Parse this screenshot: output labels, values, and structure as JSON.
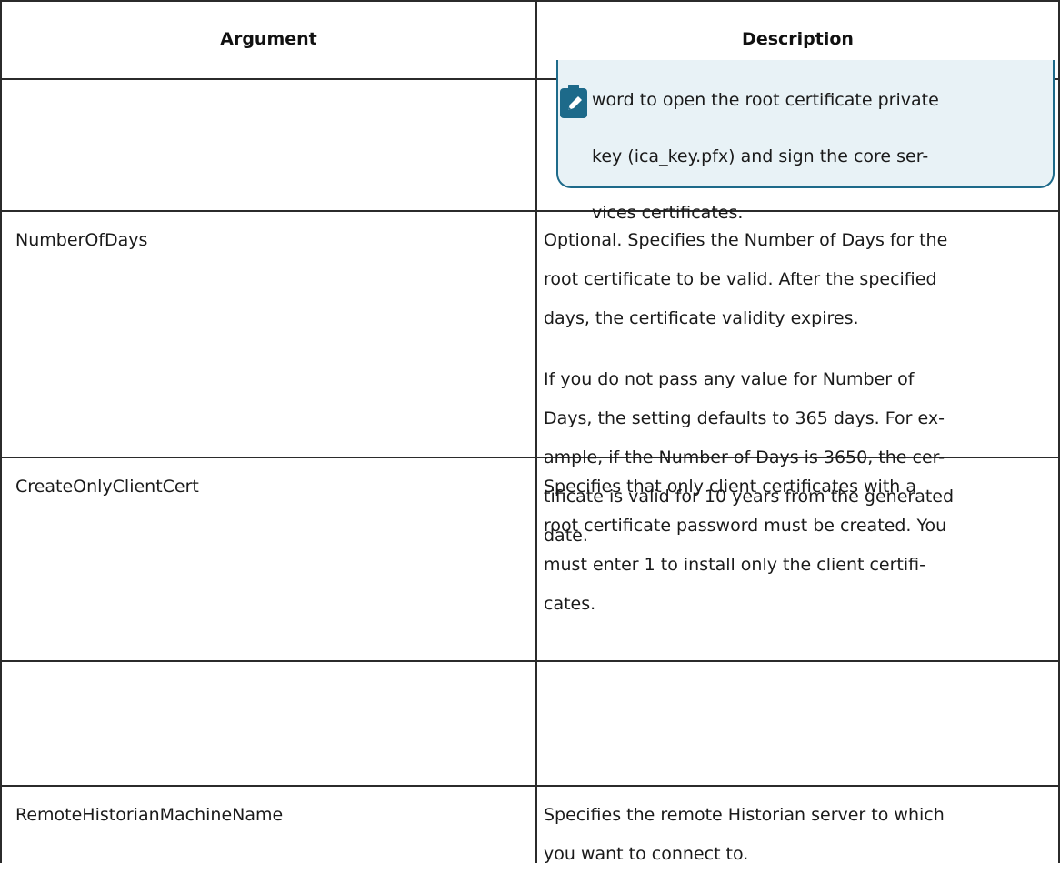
{
  "table": {
    "headers": {
      "argument": "Argument",
      "description": "Description"
    },
    "note": {
      "icon": "pencil-note-icon",
      "lines": [
        "word to open the root certificate private",
        "key (ica_key.pfx) and sign the core ser-",
        "vices certificates."
      ]
    },
    "rows": [
      {
        "argument": "NumberOfDays",
        "paragraphs": [
          [
            "Optional. Specifies the Number of Days for the",
            "root certificate to be valid. After the specified",
            "days, the certificate validity expires."
          ],
          [
            "If you do not pass any value for Number of",
            "Days, the setting defaults to 365 days. For ex-",
            "ample, if the Number of Days is 3650, the cer-",
            "tificate is valid for 10 years from the generated",
            "date."
          ]
        ]
      },
      {
        "argument": "CreateOnlyClientCert",
        "paragraphs": [
          [
            "Specifies that only client certificates with a",
            "root certificate password must be created. You",
            "must enter 1 to install only the client certifi-",
            "cates."
          ]
        ]
      },
      {
        "argument": "RemoteHistorianMachineName",
        "paragraphs": [
          [
            "Specifies the remote Historian server to which",
            "you want to connect to."
          ]
        ]
      }
    ]
  },
  "colors": {
    "note_border": "#1d6a8a",
    "note_background": "#e8f2f6",
    "icon_fill": "#1d6a8a"
  }
}
